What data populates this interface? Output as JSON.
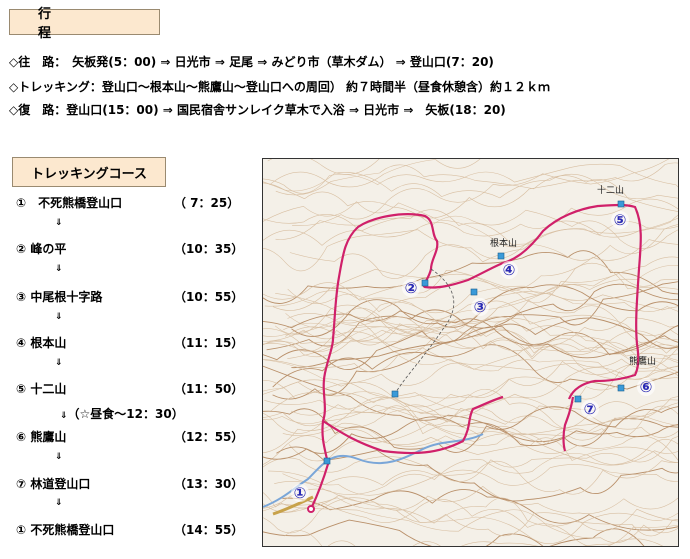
{
  "itinerary": {
    "heading": "行　程",
    "lines": [
      "◇往　路：　矢板発(5：00) ⇒ 日光市 ⇒ 足尾 ⇒ みどり市（草木ダム） ⇒ 登山口(7：20)",
      "◇トレッキング：登山口～根本山～熊鷹山～登山口への周回） 約７時間半（昼食休憩含）約１２ｋｍ",
      "◇復　路：登山口(15：00) ⇒ 国民宿舎サンレイク草木で入浴 ⇒ 日光市 ⇒　矢板(18：20)"
    ]
  },
  "course": {
    "heading": "トレッキングコース",
    "stops": [
      {
        "num": "①",
        "name": "　不死熊橋登山口",
        "time": "（ 7：25）"
      },
      {
        "num": "②",
        "name": " 峰の平",
        "time": "（10：35）"
      },
      {
        "num": "③",
        "name": " 中尾根十字路",
        "time": "（10：55）"
      },
      {
        "num": "④",
        "name": " 根本山",
        "time": "（11：15）"
      },
      {
        "num": "⑤",
        "name": " 十二山",
        "time": "（11：50）"
      },
      {
        "num": "⑥",
        "name": " 熊鷹山",
        "time": "（12：55）"
      },
      {
        "num": "⑦",
        "name": " 林道登山口",
        "time": "（13：30）"
      },
      {
        "num": "①",
        "name": " 不死熊橋登山口",
        "time": "（14：55）"
      }
    ],
    "arrow": "⇓",
    "lunch_note": "（☆昼食～12：30）"
  },
  "map": {
    "labels": {
      "nemoto": "根本山",
      "juni": "十二山",
      "kumataka": "熊鷹山"
    },
    "markers": [
      "①",
      "②",
      "③",
      "④",
      "⑤",
      "⑥",
      "⑦"
    ],
    "route_color": "#d0206a",
    "waypoint_color": "#3a9ad9",
    "marker_color": "#2a2ab4"
  }
}
